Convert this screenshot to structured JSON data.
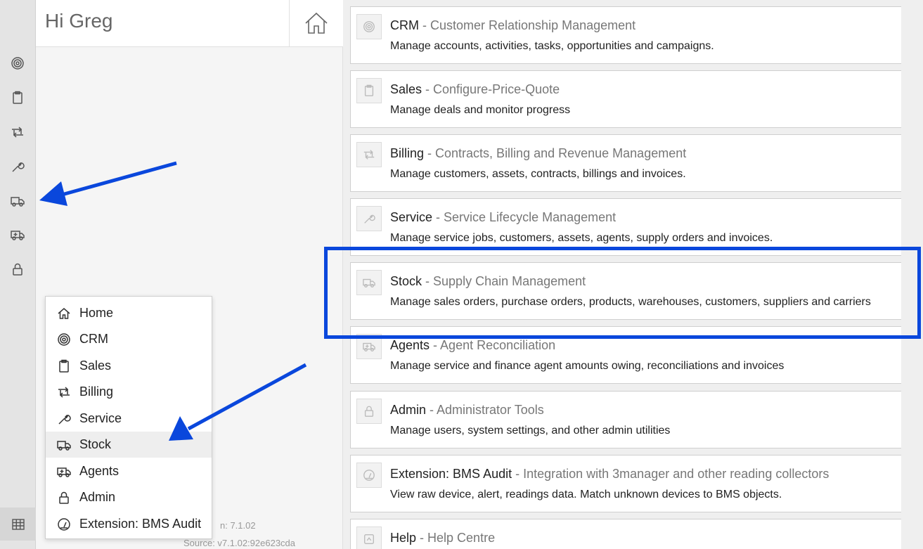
{
  "header": {
    "greeting": "Hi Greg"
  },
  "rail": {
    "icons": [
      "target-icon",
      "clipboard-icon",
      "repeat-icon",
      "wrench-icon",
      "truck-icon",
      "ambulance-icon",
      "lock-icon"
    ],
    "bottom_icon": "grid-icon"
  },
  "version": {
    "line1": "n: 7.1.02",
    "line2": "Source: v7.1.02:92e623cda"
  },
  "menu": {
    "items": [
      {
        "label": "Home",
        "icon": "home-icon"
      },
      {
        "label": "CRM",
        "icon": "target-icon"
      },
      {
        "label": "Sales",
        "icon": "clipboard-icon"
      },
      {
        "label": "Billing",
        "icon": "repeat-icon"
      },
      {
        "label": "Service",
        "icon": "wrench-icon"
      },
      {
        "label": "Stock",
        "icon": "truck-icon",
        "active": true
      },
      {
        "label": "Agents",
        "icon": "ambulance-icon"
      },
      {
        "label": "Admin",
        "icon": "lock-icon"
      },
      {
        "label": "Extension: BMS Audit",
        "icon": "gauge-icon"
      }
    ]
  },
  "modules": [
    {
      "name": "CRM",
      "subtitle": " - Customer Relationship Management",
      "description": "Manage accounts, activities, tasks, opportunities and campaigns.",
      "icon": "target-icon"
    },
    {
      "name": "Sales",
      "subtitle": " - Configure-Price-Quote",
      "description": "Manage deals and monitor progress",
      "icon": "clipboard-icon"
    },
    {
      "name": "Billing",
      "subtitle": " - Contracts, Billing and Revenue Management",
      "description": "Manage customers, assets, contracts, billings and invoices.",
      "icon": "repeat-icon"
    },
    {
      "name": "Service",
      "subtitle": " - Service Lifecycle Management",
      "description": "Manage service jobs, customers, assets, agents, supply orders and invoices.",
      "icon": "wrench-icon"
    },
    {
      "name": "Stock",
      "subtitle": " - Supply Chain Management",
      "description": "Manage sales orders, purchase orders, products, warehouses, customers, suppliers and carriers",
      "icon": "truck-icon"
    },
    {
      "name": "Agents",
      "subtitle": " - Agent Reconciliation",
      "description": "Manage service and finance agent amounts owing, reconciliations and invoices",
      "icon": "ambulance-icon"
    },
    {
      "name": "Admin",
      "subtitle": " - Administrator Tools",
      "description": "Manage users, system settings, and other admin utilities",
      "icon": "lock-icon"
    },
    {
      "name": "Extension: BMS Audit",
      "subtitle": " - Integration with 3manager and other reading collectors",
      "description": "View raw device, alert, readings data. Match unknown devices to BMS objects.",
      "icon": "gauge-icon"
    },
    {
      "name": "Help",
      "subtitle": " - Help Centre",
      "description": "",
      "icon": "help-icon"
    }
  ],
  "colors": {
    "annotation_blue": "#0a47dc",
    "rail_bg": "#e4e4e4",
    "panel_bg": "#f5f5f5"
  }
}
